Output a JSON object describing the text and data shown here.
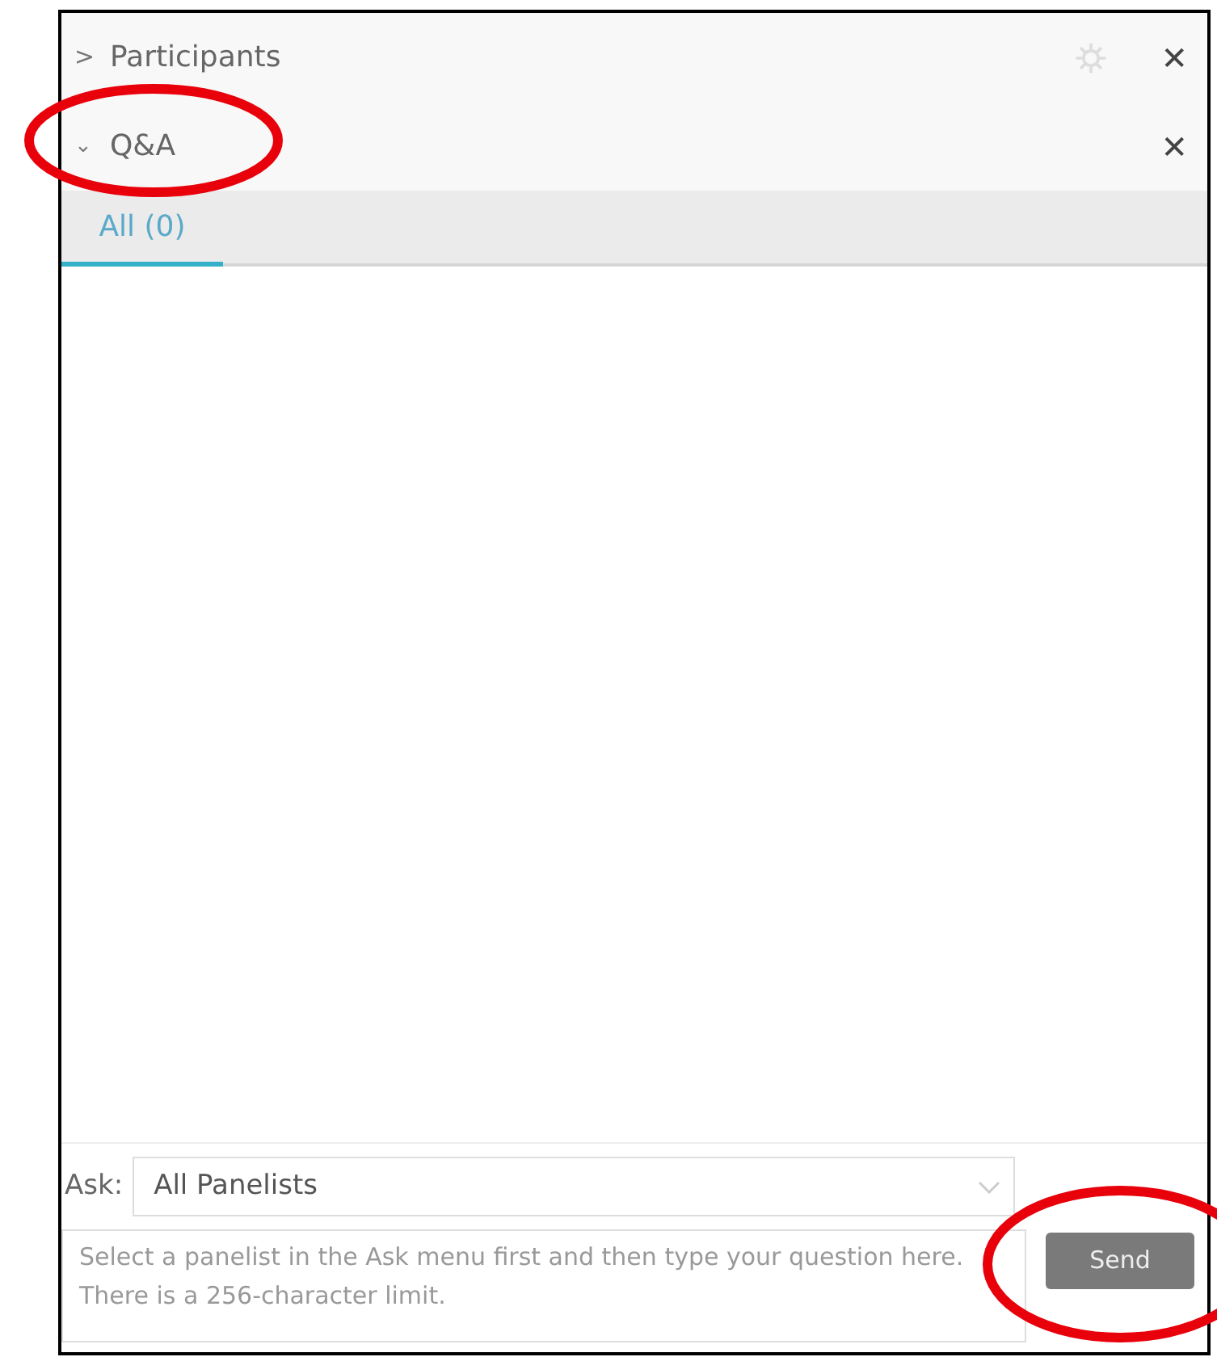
{
  "panels": [
    {
      "chevron": ">",
      "title": "Participants",
      "expanded": false,
      "has_settings": true,
      "close": "✕",
      "circled": false
    },
    {
      "chevron": "⌄",
      "title": "Q&A",
      "expanded": true,
      "has_settings": false,
      "close": "✕",
      "circled": true
    }
  ],
  "tabs": [
    {
      "label": "All (0)",
      "selected": true
    }
  ],
  "ask": {
    "label": "Ask:",
    "value": "All Panelists"
  },
  "question": {
    "placeholder": "Select a panelist in the Ask menu first and then type your question here. There is a 256-character limit."
  },
  "send": {
    "label": "Send",
    "disabled": true,
    "circled": true
  }
}
